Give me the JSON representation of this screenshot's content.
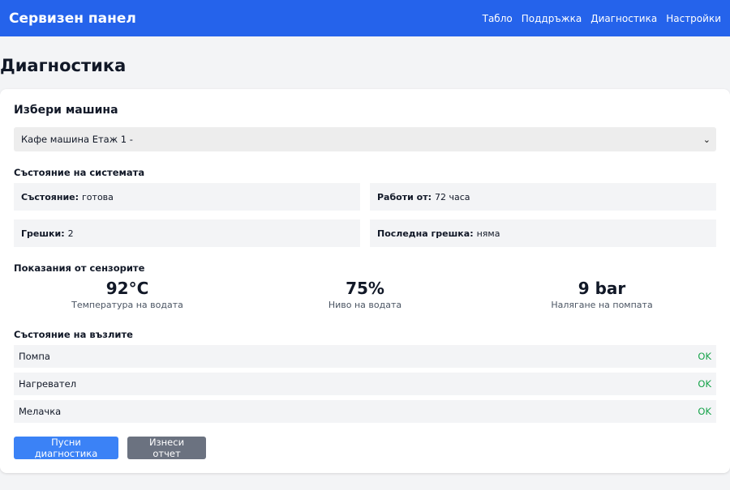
{
  "header": {
    "brand": "Сервизен панел",
    "nav": [
      "Табло",
      "Поддръжка",
      "Диагностика",
      "Настройки"
    ]
  },
  "page": {
    "title": "Диагностика"
  },
  "machine_select": {
    "heading": "Избери машина",
    "selected": "Кафе машина Етаж 1 -"
  },
  "system": {
    "heading": "Състояние на системата",
    "status_label": "Състояние:",
    "status_value": "готова",
    "uptime_label": "Работи от:",
    "uptime_value": "72 часа",
    "errors_label": "Грешки:",
    "errors_value": "2",
    "last_error_label": "Последна грешка:",
    "last_error_value": "няма"
  },
  "sensors": {
    "heading": "Показания от сензорите",
    "items": [
      {
        "value": "92°C",
        "label": "Температура на водата"
      },
      {
        "value": "75%",
        "label": "Ниво на водата"
      },
      {
        "value": "9 bar",
        "label": "Налягане на помпата"
      }
    ]
  },
  "components": {
    "heading": "Състояние на възлите",
    "items": [
      {
        "name": "Помпа",
        "status": "OK"
      },
      {
        "name": "Нагревател",
        "status": "OK"
      },
      {
        "name": "Мелачка",
        "status": "OK"
      }
    ]
  },
  "actions": {
    "run_label": "Пусни диагностика",
    "export_label": "Изнеси отчет"
  },
  "colors": {
    "accent": "#2563eb",
    "ok": "#16a34a",
    "secondary": "#6b7280"
  }
}
